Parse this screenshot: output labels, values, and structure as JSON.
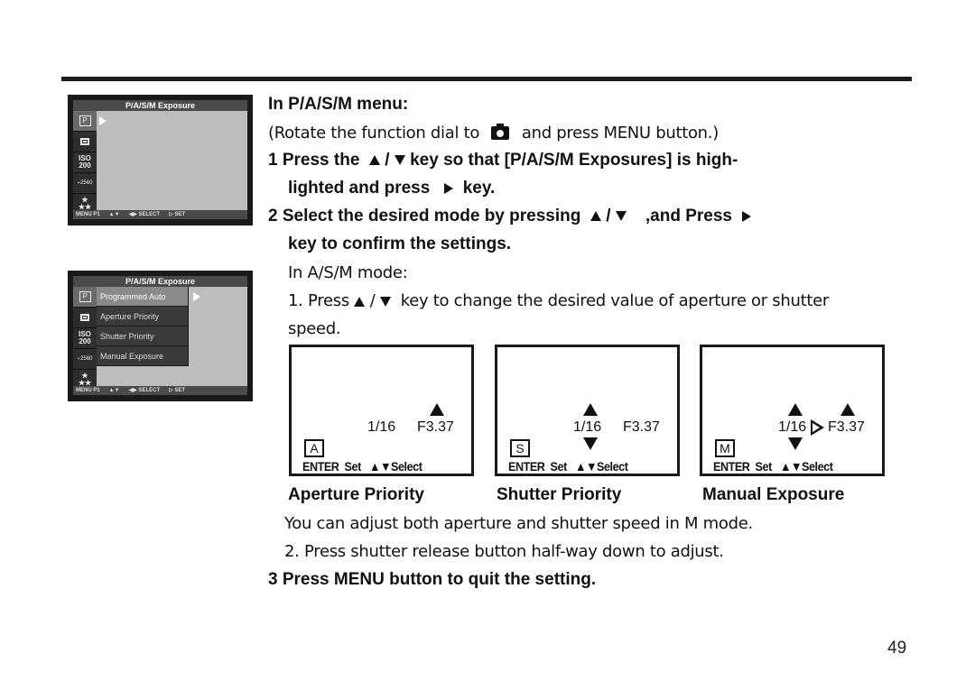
{
  "page": {
    "page_number": "49"
  },
  "lcd_screen_1": {
    "title": "P/A/S/M Exposure",
    "side_icons": [
      "P",
      "frame",
      "ISO 200",
      "2560",
      "stars"
    ],
    "footer": [
      "MENU P1",
      "▲▼",
      "◀▶ SELECT",
      "▷ SET"
    ]
  },
  "lcd_screen_2": {
    "title": "P/A/S/M Exposure",
    "side_icons": [
      "P",
      "frame",
      "ISO 200",
      "2560",
      "stars"
    ],
    "menu_items": [
      "Programmed Auto",
      "Aperture Priority",
      "Shutter Priority",
      "Manual Exposure"
    ],
    "selected_index": 0,
    "footer": [
      "MENU P1",
      "▲▼",
      "◀▶ SELECT",
      "▷ SET"
    ]
  },
  "instructions": {
    "heading": "In P/A/S/M menu:",
    "intro_pre": "(Rotate the function dial to",
    "intro_post": "and press MENU button.)",
    "step1_a": "1 Press the",
    "step1_sep": "/",
    "step1_b": "key so that [P/A/S/M Exposures] is high-",
    "step1_c": "lighted and press",
    "step1_d": "key.",
    "step2_a": "2 Select the desired mode by pressing",
    "step2_sep": "/",
    "step2_b": ",and Press",
    "step2_c": "key to confirm the settings.",
    "asm_heading": "In A/S/M mode:",
    "sub1_a": "1. Press",
    "sub1_sep": "/",
    "sub1_b": "key to change the desired value of aperture or shutter",
    "sub1_c": "speed.",
    "note": "You can adjust both aperture and shutter speed in M mode.",
    "sub2": "2. Press shutter release button half-way down to adjust.",
    "step3": "3 Press MENU button to quit the setting."
  },
  "mode_screens": [
    {
      "caption": "Aperture Priority",
      "letter": "A",
      "shutter": "1/16",
      "aperture": "F3.37",
      "footer_enter": "ENTER",
      "footer_set": "Set",
      "footer_select": "▲▼Select"
    },
    {
      "caption": "Shutter Priority",
      "letter": "S",
      "shutter": "1/16",
      "aperture": "F3.37",
      "footer_enter": "ENTER",
      "footer_set": "Set",
      "footer_select": "▲▼Select"
    },
    {
      "caption": "Manual Exposure",
      "letter": "M",
      "shutter": "1/16",
      "aperture": "F3.37",
      "footer_enter": "ENTER",
      "footer_set": "Set",
      "footer_select": "▲▼Select"
    }
  ]
}
